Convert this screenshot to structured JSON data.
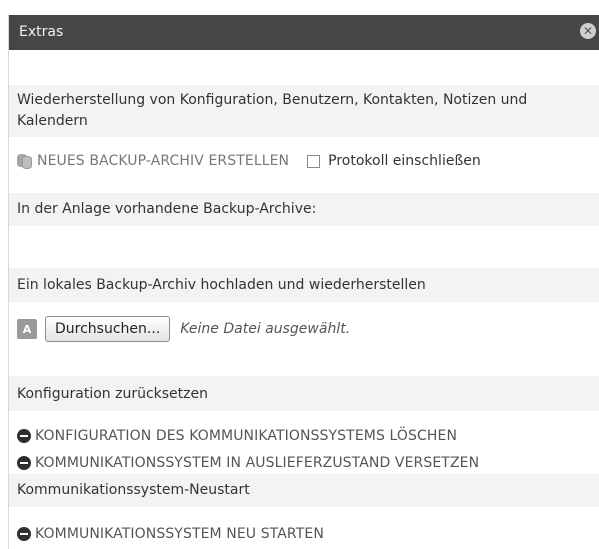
{
  "dialog": {
    "title": "Extras",
    "close_glyph": "✕",
    "sections": {
      "restore_heading": "Wiederherstellung von Konfiguration, Benutzern, Kontakten, Notizen und Kalendern",
      "create_backup_label": "NEUES BACKUP-ARCHIV ERSTELLEN",
      "protocol_checkbox_label": "Protokoll einschließen",
      "protocol_checked": false,
      "existing_archives_heading": "In der Anlage vorhandene Backup-Archive:",
      "upload_heading": "Ein lokales Backup-Archiv hochladen und wiederherstellen",
      "upload_icon_glyph": "A",
      "browse_button_label": "Durchsuchen...",
      "no_file_text": "Keine Datei ausgewählt.",
      "reset_heading": "Konfiguration zurücksetzen",
      "reset_delete_label": "KONFIGURATION DES KOMMUNIKATIONSSYSTEMS LÖSCHEN",
      "reset_factory_label": "KOMMUNIKATIONSSYSTEM IN AUSLIEFERZUSTAND VERSETZEN",
      "restart_heading": "Kommunikationssystem-Neustart",
      "restart_label": "KOMMUNIKATIONSSYSTEM NEU STARTEN"
    }
  },
  "colors": {
    "titlebar": "#464646",
    "row_shade": "#f3f3f3",
    "text": "#333333"
  },
  "icons": {
    "backup": "database-icon",
    "minus": "minus-circle-icon",
    "upload": "upload-icon",
    "close": "close-icon"
  }
}
